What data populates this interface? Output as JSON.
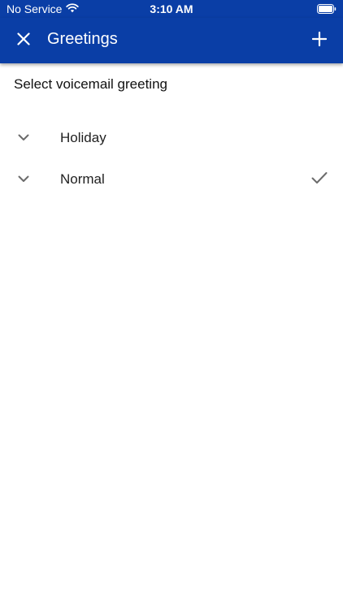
{
  "status_bar": {
    "carrier": "No Service",
    "time": "3:10 AM"
  },
  "app_bar": {
    "title": "Greetings"
  },
  "section": {
    "heading": "Select voicemail greeting"
  },
  "greetings": [
    {
      "label": "Holiday",
      "selected": false
    },
    {
      "label": "Normal",
      "selected": true
    }
  ],
  "icons": {
    "close": "close-icon",
    "add": "plus-icon",
    "expand": "chevron-down-icon",
    "selected": "check-icon",
    "wifi": "wifi-icon",
    "battery": "battery-icon"
  },
  "colors": {
    "brand": "#0a3ea6",
    "icon_gray": "#6b6b6b"
  }
}
